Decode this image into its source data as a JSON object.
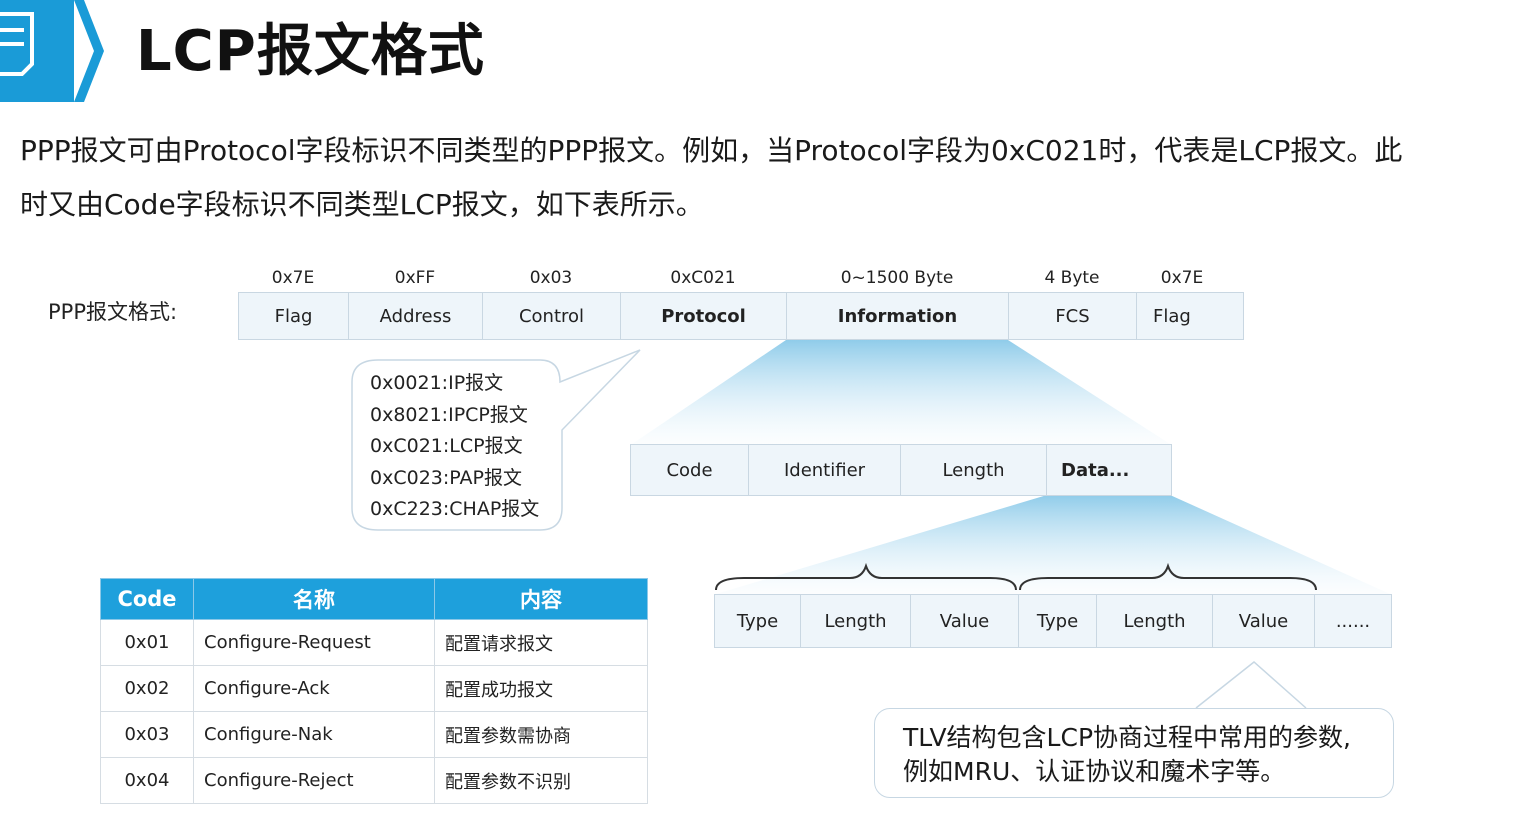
{
  "title": "LCP报文格式",
  "intro": {
    "line1": "PPP报文可由Protocol字段标识不同类型的PPP报文。例如，当Protocol字段为0xC021时，代表是LCP报文。此",
    "line2": "时又由Code字段标识不同类型LCP报文，如下表所示。"
  },
  "ppp_format": {
    "label": "PPP报文格式:",
    "fields": [
      {
        "value": "0x7E",
        "name": "Flag"
      },
      {
        "value": "0xFF",
        "name": "Address"
      },
      {
        "value": "0x03",
        "name": "Control"
      },
      {
        "value": "0xC021",
        "name": "Protocol"
      },
      {
        "value": "0~1500 Byte",
        "name": "Information"
      },
      {
        "value": "4 Byte",
        "name": "FCS"
      },
      {
        "value": "0x7E",
        "name": "Flag"
      }
    ]
  },
  "protocol_values": [
    "0x0021:IP报文",
    "0x8021:IPCP报文",
    "0xC021:LCP报文",
    "0xC023:PAP报文",
    "0xC223:CHAP报文"
  ],
  "lcp_fields": [
    "Code",
    "Identifier",
    "Length",
    "Data..."
  ],
  "tlv_fields": [
    "Type",
    "Length",
    "Value",
    "Type",
    "Length",
    "Value",
    "......"
  ],
  "code_table": {
    "headers": [
      "Code",
      "名称",
      "内容"
    ],
    "rows": [
      [
        "0x01",
        "Configure-Request",
        "配置请求报文"
      ],
      [
        "0x02",
        "Configure-Ack",
        "配置成功报文"
      ],
      [
        "0x03",
        "Configure-Nak",
        "配置参数需协商"
      ],
      [
        "0x04",
        "Configure-Reject",
        "配置参数不识别"
      ]
    ]
  },
  "note": {
    "line1": "TLV结构包含LCP协商过程中常用的参数,",
    "line2": "例如MRU、认证协议和魔术字等。"
  },
  "colors": {
    "title_accent": "#1a9bd7",
    "table_header": "#1ea0dc",
    "code_highlight": "#c0392b",
    "field_bg": "#eef5fa"
  }
}
